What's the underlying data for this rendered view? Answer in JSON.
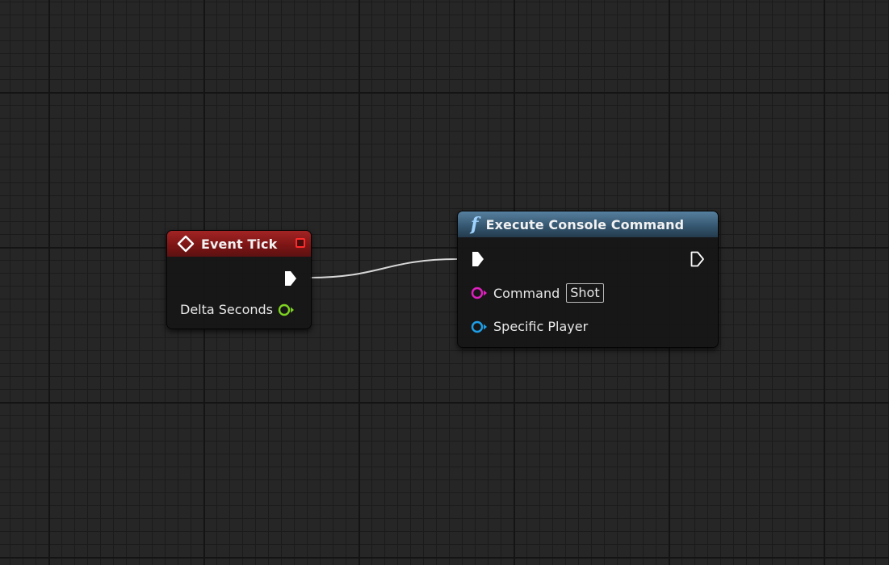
{
  "graph": {
    "nodes": {
      "event_tick": {
        "title": "Event Tick",
        "pins": {
          "exec_out": {
            "type": "exec"
          },
          "delta_seconds": {
            "label": "Delta Seconds",
            "type": "float"
          }
        }
      },
      "execute_console_command": {
        "title": "Execute Console Command",
        "icon": "f",
        "pins": {
          "exec_in": {
            "type": "exec"
          },
          "exec_out": {
            "type": "exec"
          },
          "command": {
            "label": "Command",
            "value": "Shot",
            "type": "string"
          },
          "specific_player": {
            "label": "Specific Player",
            "type": "object"
          }
        }
      }
    },
    "colors": {
      "event_header": "#8b1c1c",
      "function_header": "#3f6380",
      "float_pin": "#7ed321",
      "string_pin": "#e020c0",
      "object_pin": "#1e9fe8",
      "delegate_pin": "#ff2b2b",
      "exec_pin": "#ffffff"
    }
  }
}
